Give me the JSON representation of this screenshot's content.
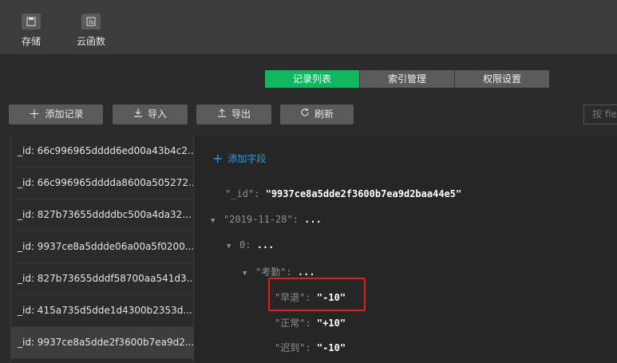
{
  "toolbar": {
    "save_label": "存储",
    "cloud_label": "云函数"
  },
  "tabs": [
    {
      "label": "记录列表",
      "active": true
    },
    {
      "label": "索引管理",
      "active": false
    },
    {
      "label": "权限设置",
      "active": false
    }
  ],
  "actions": {
    "add_record": "添加记录",
    "import": "导入",
    "export": "导出",
    "refresh": "刷新"
  },
  "search": {
    "placeholder": "按 fie"
  },
  "records": [
    "_id: 66c996965dddd6ed00a43b4c2...",
    "_id: 66c996965dddda8600a505272...",
    "_id: 827b73655ddddbc500a4da32...",
    "_id: 9937ce8a5ddde06a00a5f0200...",
    "_id: 827b73655dddf58700aa541d3...",
    "_id: 415a735d5dde1d4300b2353d...",
    "_id: 9937ce8a5dde2f3600b7ea9d2..."
  ],
  "detail": {
    "add_field": "添加字段",
    "id_key": "\"_id\":",
    "id_val": "\"9937ce8a5dde2f3600b7ea9d2baa44e5\"",
    "date_key": "\"2019-11-28\":",
    "date_val": "...",
    "idx_key": "0:",
    "idx_val": "...",
    "att_key": "\"考勤\":",
    "att_val": "...",
    "early_key": "\"早退\":",
    "early_val": "\"-10\"",
    "normal_key": "\"正常\":",
    "normal_val": "\"+10\"",
    "late_key": "\"迟到\":",
    "late_val": "\"-10\""
  },
  "colors": {
    "accent": "#0fb85e",
    "link": "#2f9bd8",
    "highlight": "#e02020"
  }
}
